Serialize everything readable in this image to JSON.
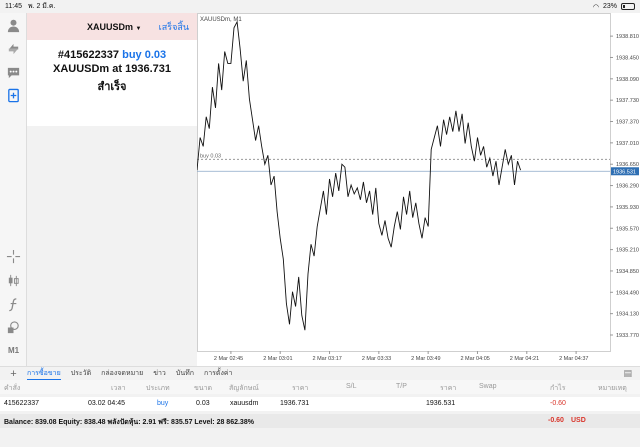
{
  "status_bar": {
    "time": "11:45",
    "date": "พ. 2 มี.ค.",
    "battery": "23%",
    "battery_fraction": 0.23
  },
  "order_panel": {
    "symbol": "XAUUSDm",
    "done_label": "เสร็จสิ้น",
    "order_id": "#415622337",
    "order_action": "buy 0.03",
    "price_line_prefix": "XAUUSDm at",
    "price": "1936.731",
    "result": "สำเร็จ"
  },
  "left_tools": {
    "icons": [
      "account-icon",
      "trade-arrows-icon",
      "chat-icon",
      "new-order-icon",
      "crosshair-icon",
      "candles-icon",
      "function-icon",
      "objects-icon"
    ],
    "timeframe": "M1"
  },
  "chart_data": {
    "type": "line",
    "title": "XAUUSDm, M1",
    "order_line_label": "buy 0.03",
    "order_line_price": 1936.731,
    "bid_price": 1936.531,
    "bid_label": "1936.531",
    "ylim": [
      1933.5,
      1939.2
    ],
    "y_ticks": [
      "1938.810",
      "1938.450",
      "1938.090",
      "1937.730",
      "1937.370",
      "1937.010",
      "1936.650",
      "1936.290",
      "1935.930",
      "1935.570",
      "1935.210",
      "1934.850",
      "1934.490",
      "1934.130",
      "1933.770"
    ],
    "x_ticks": [
      "2 Mar 02:45",
      "2 Mar 03:01",
      "2 Mar 03:17",
      "2 Mar 03:33",
      "2 Mar 03:49",
      "2 Mar 04:05",
      "2 Mar 04:21",
      "2 Mar 04:37"
    ],
    "x_tick_times": [
      0,
      16,
      32,
      48,
      64,
      80,
      96,
      112
    ],
    "xlim": [
      -11,
      123
    ],
    "x": [
      -11,
      -10,
      -9,
      -8,
      -7,
      -6,
      -5,
      -4,
      -3,
      -2,
      -1,
      0,
      1,
      2,
      3,
      4,
      5,
      6,
      7,
      8,
      9,
      10,
      11,
      12,
      13,
      14,
      15,
      16,
      17,
      18,
      19,
      20,
      21,
      22,
      23,
      24,
      25,
      26,
      27,
      28,
      29,
      30,
      31,
      32,
      33,
      34,
      35,
      36,
      37,
      38,
      39,
      40,
      41,
      42,
      43,
      44,
      45,
      46,
      47,
      48,
      49,
      50,
      51,
      52,
      53,
      54,
      55,
      56,
      57,
      58,
      59,
      60,
      61,
      62,
      63,
      64,
      65,
      66,
      67,
      68,
      69,
      70,
      71,
      72,
      73,
      74,
      75,
      76,
      77,
      78,
      79,
      80,
      81,
      82,
      83,
      84,
      85,
      86,
      87,
      88,
      89,
      90,
      91,
      92,
      93,
      94,
      95,
      96,
      97,
      98,
      99,
      100,
      101,
      102,
      103,
      104,
      105,
      106,
      107,
      108,
      109,
      110,
      111,
      112,
      113,
      114,
      115,
      116,
      117,
      118,
      119,
      120,
      121,
      122
    ],
    "values": [
      1936.55,
      1937.1,
      1936.95,
      1937.45,
      1937.25,
      1937.95,
      1937.6,
      1938.35,
      1937.9,
      1938.55,
      1938.35,
      1938.35,
      1938.95,
      1939.05,
      1938.6,
      1938.05,
      1938.4,
      1937.75,
      1937.4,
      1937.05,
      1937.3,
      1936.95,
      1936.65,
      1936.8,
      1936.3,
      1936.45,
      1935.85,
      1935.4,
      1935.05,
      1934.3,
      1933.95,
      1934.5,
      1934.25,
      1934.75,
      1934.1,
      1933.85,
      1934.8,
      1935.3,
      1935.1,
      1935.6,
      1935.9,
      1936.2,
      1935.8,
      1936.4,
      1936.1,
      1936.5,
      1936.2,
      1936.65,
      1936.6,
      1936.1,
      1936.3,
      1936.15,
      1936.25,
      1936.05,
      1936.35,
      1936.0,
      1936.2,
      1935.8,
      1936.25,
      1935.65,
      1935.45,
      1935.7,
      1935.4,
      1935.25,
      1935.6,
      1935.85,
      1935.55,
      1936.1,
      1935.8,
      1936.2,
      1935.75,
      1936.0,
      1935.65,
      1935.4,
      1935.75,
      1935.6,
      1936.9,
      1937.1,
      1937.3,
      1936.95,
      1937.4,
      1937.15,
      1937.45,
      1937.2,
      1937.55,
      1937.2,
      1937.5,
      1937.0,
      1937.35,
      1936.95,
      1936.7,
      1937.1,
      1936.8,
      1936.95,
      1936.6,
      1936.75,
      1936.45,
      1936.7,
      1936.3,
      1936.6,
      1936.9,
      1936.65,
      1936.8,
      1936.3,
      1936.7,
      1936.55
    ],
    "grid": false
  },
  "tabs": [
    "การซื้อขาย",
    "ประวัติ",
    "กล่องจดหมาย",
    "ข่าว",
    "บันทึก",
    "การตั้งค่า"
  ],
  "table": {
    "headers": [
      "คำสั่ง",
      "เวลา",
      "ประเภท",
      "ขนาด",
      "สัญลักษณ์",
      "ราคา",
      "S/L",
      "T/P",
      "ราคา",
      "Swap",
      "กำไร",
      "หมายเหตุ"
    ],
    "row": {
      "order": "415622337",
      "time": "03.02 04:45",
      "type": "buy",
      "size": "0.03",
      "symbol": "xauusdm",
      "price": "1936.731",
      "current_price": "1936.531",
      "profit": "-0.60"
    }
  },
  "balance_bar": {
    "text": "Balance: 839.08 Equity: 838.48 พลังปัดหุ้น: 2.91 ฟรี: 835.57 Level: 28 862.38%",
    "profit": "-0.60",
    "currency": "USD"
  },
  "colors": {
    "accent": "#1a73e8",
    "loss": "#d9352b",
    "order_header": "#f7e2e2",
    "bid_box": "#2f6fb3"
  }
}
